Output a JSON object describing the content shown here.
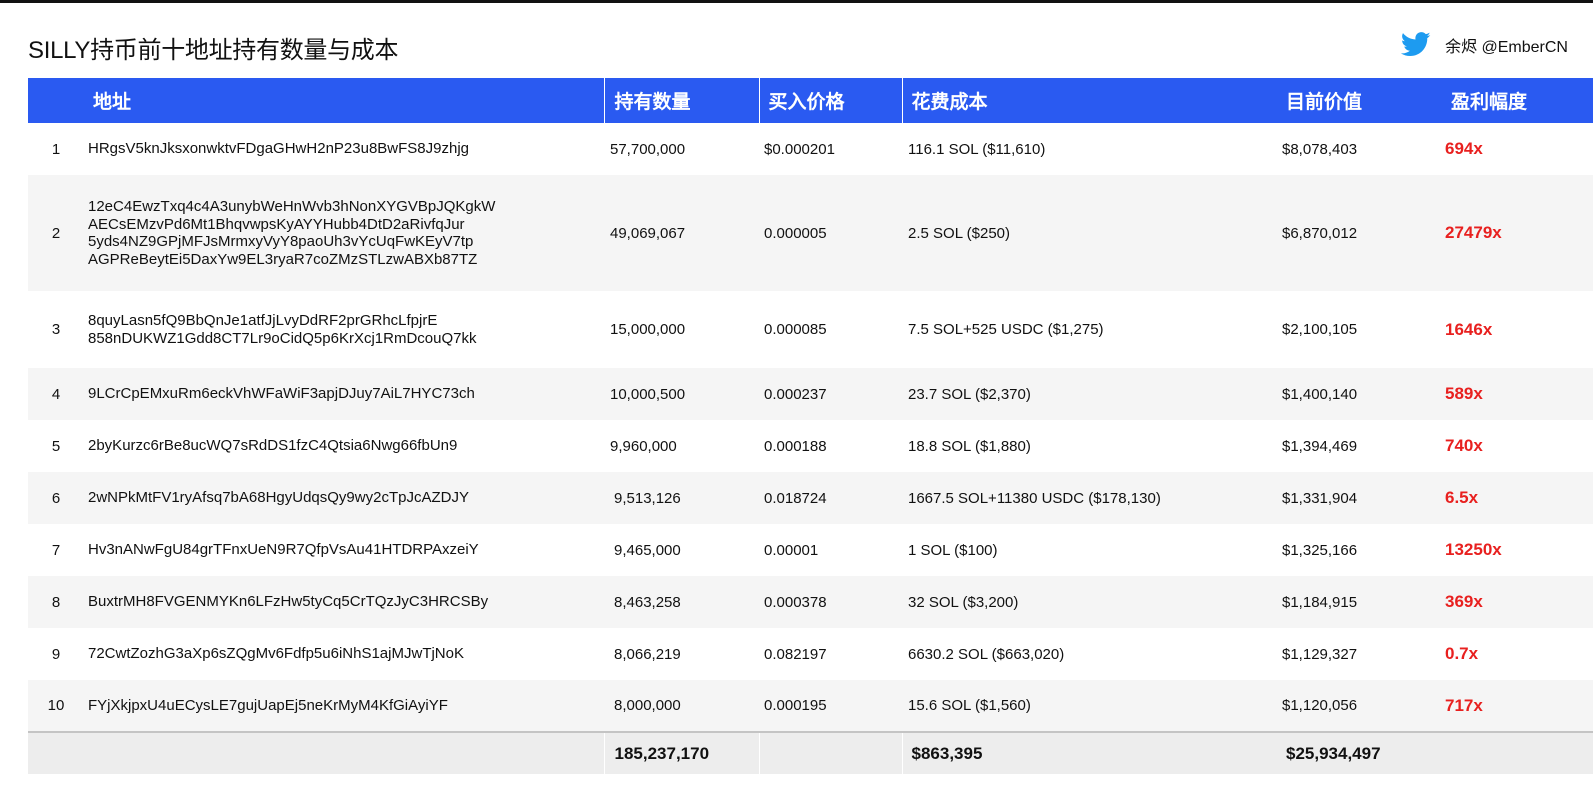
{
  "title": "SILLY持币前十地址持有数量与成本",
  "credit": {
    "icon": "twitter-bird-icon",
    "text": "余烬 @EmberCN"
  },
  "colors": {
    "header_bg": "#2a5af1",
    "profit_text": "#e8201f",
    "stripe": "#f5f5f5"
  },
  "table": {
    "headers": [
      "",
      "地址",
      "持有数量",
      "买入价格",
      "花费成本",
      "目前价值",
      "盈利幅度"
    ],
    "rows": [
      {
        "rank": "1",
        "address": [
          "HRgsV5knJksxonwktvFDgaGHwH2nP23u8BwFS8J9zhjg"
        ],
        "amount": "57,700,000",
        "price": "$0.000201",
        "cost": "116.1 SOL ($11,610)",
        "value": "$8,078,403",
        "profit": "694x"
      },
      {
        "rank": "2",
        "address": [
          "12eC4EwzTxq4c4A3unybWeHnWvb3hNonXYGVBpJQKgkW",
          "AECsEMzvPd6Mt1BhqvwpsKyAYYHubb4DtD2aRivfqJur",
          "5yds4NZ9GPjMFJsMrmxyVyY8paoUh3vYcUqFwKEyV7tp",
          "AGPReBeytEi5DaxYw9EL3ryaR7coZMzSTLzwABXb87TZ"
        ],
        "amount": "49,069,067",
        "price": "0.000005",
        "cost": "2.5 SOL ($250)",
        "value": "$6,870,012",
        "profit": "27479x"
      },
      {
        "rank": "3",
        "address": [
          "8quyLasn5fQ9BbQnJe1atfJjLvyDdRF2prGRhcLfpjrE",
          "858nDUKWZ1Gdd8CT7Lr9oCidQ5p6KrXcj1RmDcouQ7kk"
        ],
        "amount": "15,000,000",
        "price": "0.000085",
        "cost": "7.5 SOL+525 USDC ($1,275)",
        "value": "$2,100,105",
        "profit": "1646x"
      },
      {
        "rank": "4",
        "address": [
          "9LCrCpEMxuRm6eckVhWFaWiF3apjDJuy7AiL7HYC73ch"
        ],
        "amount": "10,000,500",
        "price": "0.000237",
        "cost": "23.7 SOL ($2,370)",
        "value": "$1,400,140",
        "profit": "589x"
      },
      {
        "rank": "5",
        "address": [
          "2byKurzc6rBe8ucWQ7sRdDS1fzC4Qtsia6Nwg66fbUn9"
        ],
        "amount": "9,960,000",
        "price": "0.000188",
        "cost": "18.8 SOL ($1,880)",
        "value": "$1,394,469",
        "profit": "740x"
      },
      {
        "rank": "6",
        "address": [
          "2wNPkMtFV1ryAfsq7bA68HgyUdqsQy9wy2cTpJcAZDJY"
        ],
        "amount": "9,513,126",
        "price": "0.018724",
        "cost": "1667.5 SOL+11380 USDC  ($178,130)",
        "value": "$1,331,904",
        "profit": "6.5x"
      },
      {
        "rank": "7",
        "address": [
          "Hv3nANwFgU84grTFnxUeN9R7QfpVsAu41HTDRPAxzeiY"
        ],
        "amount": "9,465,000",
        "price": "0.00001",
        "cost": "1 SOL ($100)",
        "value": "$1,325,166",
        "profit": "13250x"
      },
      {
        "rank": "8",
        "address": [
          "BuxtrMH8FVGENMYKn6LFzHw5tyCq5CrTQzJyC3HRCSBy"
        ],
        "amount": "8,463,258",
        "price": "0.000378",
        "cost": "32 SOL ($3,200)",
        "value": "$1,184,915",
        "profit": "369x"
      },
      {
        "rank": "9",
        "address": [
          "72CwtZozhG3aXp6sZQgMv6Fdfp5u6iNhS1ajMJwTjNoK"
        ],
        "amount": "8,066,219",
        "price": "0.082197",
        "cost": "6630.2 SOL ($663,020)",
        "value": "$1,129,327",
        "profit": "0.7x"
      },
      {
        "rank": "10",
        "address": [
          "FYjXkjpxU4uECysLE7gujUapEj5neKrMyM4KfGiAyiYF"
        ],
        "amount": "8,000,000",
        "price": "0.000195",
        "cost": "15.6 SOL ($1,560)",
        "value": "$1,120,056",
        "profit": "717x"
      }
    ],
    "totals": {
      "amount": "185,237,170",
      "cost": "$863,395",
      "value": "$25,934,497"
    }
  }
}
